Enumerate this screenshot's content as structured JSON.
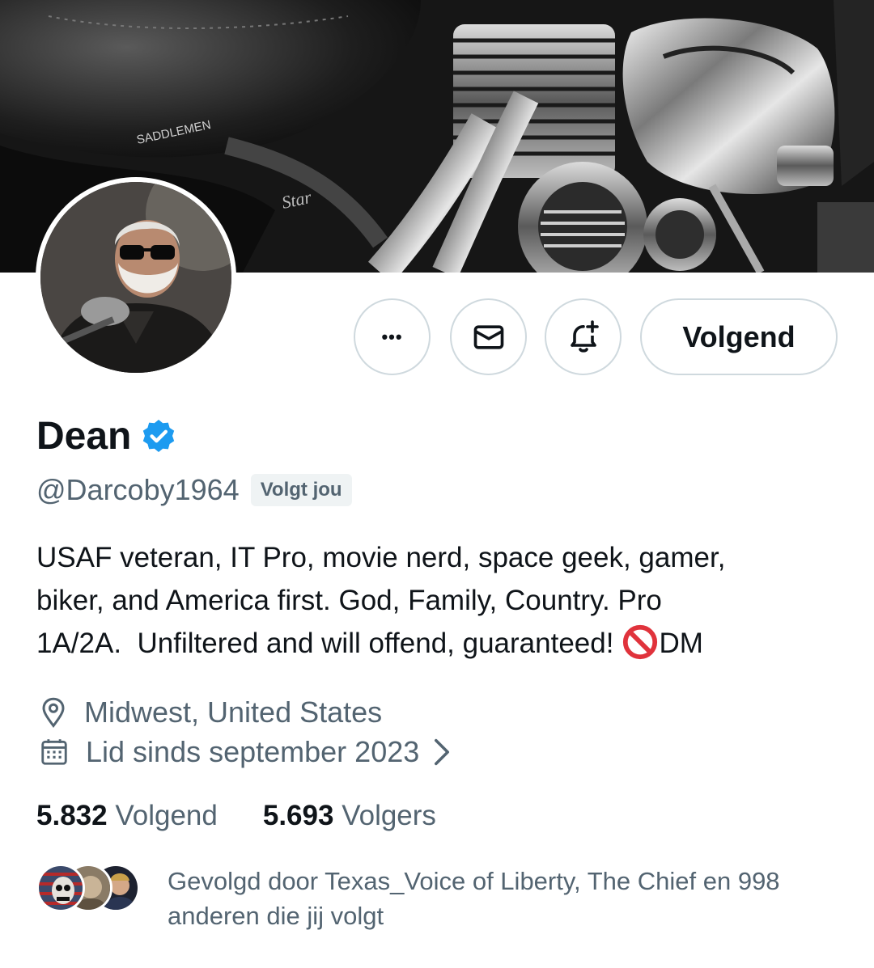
{
  "banner": {
    "seat_brand_text": "SADDLEMEN",
    "tank_badge_text": "Star"
  },
  "actions": {
    "more_glyph": "•••",
    "follow_label": "Volgend"
  },
  "profile": {
    "name": "Dean",
    "handle": "@Darcoby1964",
    "follows_you_badge": "Volgt jou",
    "bio_lines": [
      "USAF veteran, IT Pro, movie nerd, space geek, gamer,",
      "biker, and America first. God, Family, Country. Pro",
      "1A/2A.  Unfiltered and will offend, guaranteed!"
    ],
    "bio_dm_suffix": "DM",
    "location": "Midwest, United States",
    "joined": "Lid sinds september 2023"
  },
  "stats": {
    "following_count": "5.832",
    "following_label": "Volgend",
    "followers_count": "5.693",
    "followers_label": "Volgers"
  },
  "followed_by": {
    "text": "Gevolgd door Texas_Voice of Liberty, The Chief en 998 anderen die jij volgt"
  },
  "colors": {
    "verified_blue": "#1d9bf0",
    "secondary_text": "#536471",
    "primary_text": "#0f1419",
    "border": "#cfd9de",
    "no_entry_red": "#e0333c"
  },
  "icons": {
    "more": "more-horizontal-icon",
    "message": "envelope-icon",
    "notify": "bell-plus-icon",
    "verified": "verified-badge-icon",
    "location": "location-pin-icon",
    "calendar": "calendar-icon",
    "chevron": "chevron-right-icon",
    "no_entry": "no-entry-emoji-icon"
  }
}
